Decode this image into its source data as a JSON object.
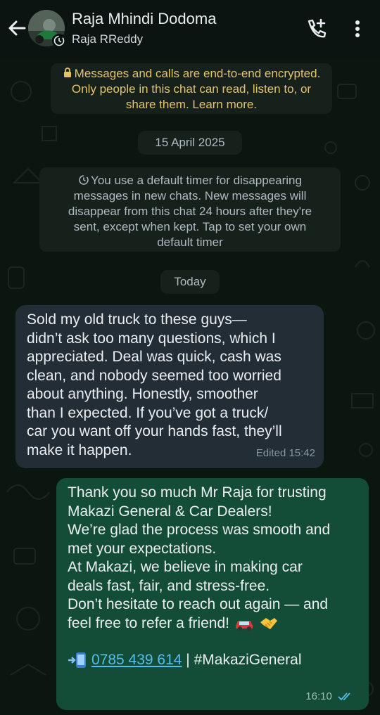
{
  "header": {
    "title": "Raja Mhindi Dodoma",
    "subtitle": "Raja RReddy"
  },
  "notices": {
    "encryption": [
      "Messages and calls are end-to-end encrypted.",
      "Only people in this chat can read, listen to, or",
      "share them. Learn more."
    ],
    "date_chip": "15 April 2025",
    "timer": [
      "You use a default timer for disappearing",
      "messages in new chats. New messages will",
      "disappear from this chat 24 hours after they're",
      "sent, except when kept. Tap to set your own",
      "default timer"
    ],
    "today_chip": "Today"
  },
  "messages": {
    "incoming": {
      "lines": [
        "Sold my old truck to these guys—",
        "didn’t ask too many questions, which I",
        "appreciated. Deal was quick, cash was",
        "clean, and nobody seemed too worried",
        "about anything.  Honestly, smoother",
        "than I expected. If you’ve got a truck/",
        "car you want off your hands fast, they’ll",
        "make it happen."
      ],
      "meta": "Edited 15:42"
    },
    "outgoing": {
      "lines": [
        "Thank you so much Mr Raja for trusting",
        "Makazi General & Car Dealers!",
        "We’re glad the process was smooth and",
        "met your expectations.",
        "At Makazi, we believe in making car",
        "deals fast, fair, and stress-free.",
        "Don’t hesitate to reach out again — and",
        "feel free to refer a friend!"
      ],
      "phone": "0785 439 614",
      "hashtag": " | #MakaziGeneral",
      "time": "16:10"
    }
  },
  "colors": {
    "header_bg": "#0b1410",
    "incoming_bubble": "#232d36",
    "outgoing_bubble": "#144d37",
    "encryption_text": "#e3c46a",
    "link": "#53bdeb",
    "read_ticks": "#53bdeb"
  },
  "icons": {
    "back": "arrow-left-icon",
    "call": "add-call-icon",
    "menu": "more-vertical-icon",
    "lock": "lock-icon",
    "timer": "timer-icon",
    "ticks": "double-check-icon"
  }
}
